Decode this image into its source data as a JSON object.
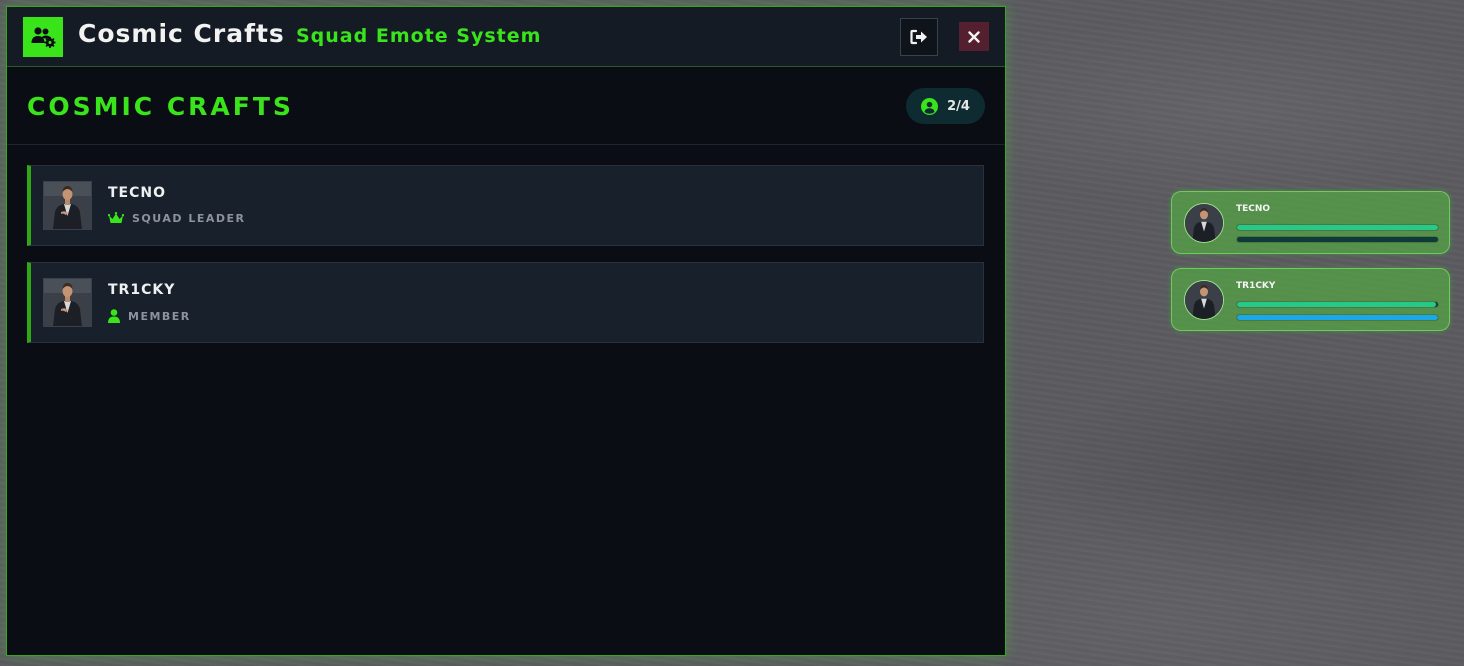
{
  "window": {
    "title": "Cosmic Crafts",
    "subtitle": "Squad Emote System",
    "app_icon": "users-gear-icon",
    "leave_icon": "sign-out-icon",
    "close_icon": "close-icon"
  },
  "squad": {
    "name": "COSMIC CRAFTS",
    "count_icon": "user-circle-icon",
    "member_count": "2/4"
  },
  "members": [
    {
      "name": "TECNO",
      "role": "SQUAD LEADER",
      "role_icon": "crown-icon"
    },
    {
      "name": "TR1CKY",
      "role": "MEMBER",
      "role_icon": "user-icon"
    }
  ],
  "hud": [
    {
      "name": "TECNO",
      "health": 1.0,
      "armor": 1.0,
      "health_color": "#25c98a",
      "armor_color": "#103a3a"
    },
    {
      "name": "TR1CKY",
      "health": 0.99,
      "armor": 1.0,
      "health_color": "#25c98a",
      "armor_color": "#1aa8e8"
    }
  ],
  "colors": {
    "accent": "#39e51a",
    "panel_bg": "#0a0d13",
    "card_bg": "#18202b",
    "close_bg": "#54202f"
  }
}
